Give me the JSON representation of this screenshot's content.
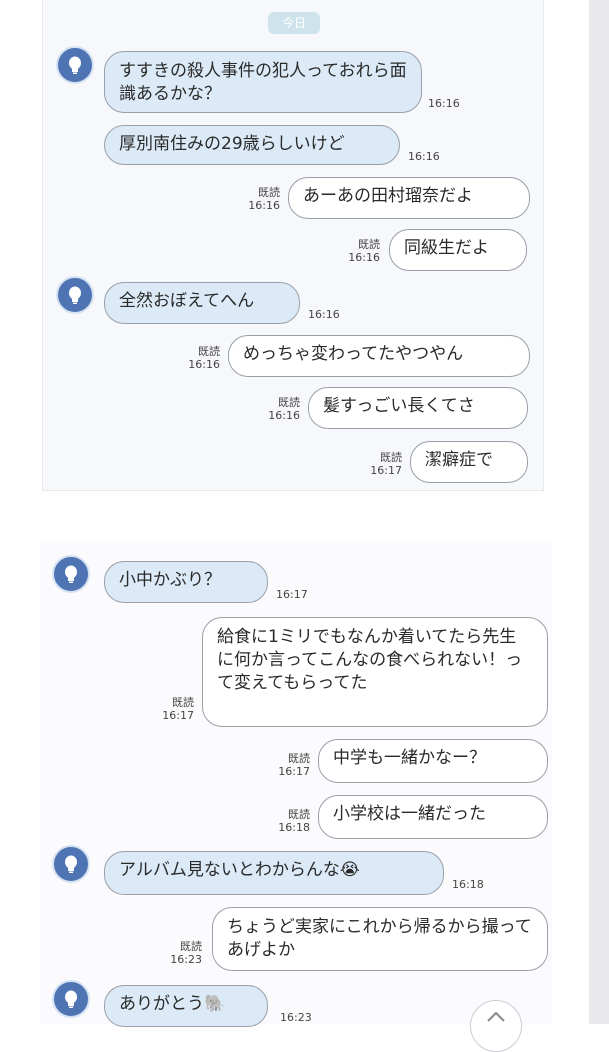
{
  "date_label": "今日",
  "read_label": "既読",
  "top_messages": [
    {
      "side": "left",
      "text": "すすきの殺人事件の犯人っておれら面識あるかな？",
      "time": "16:16"
    },
    {
      "side": "left",
      "text": "厚別南住みの29歳らしいけど",
      "time": "16:16"
    },
    {
      "side": "right",
      "text": "あーあの田村瑠奈だよ",
      "time": "16:16"
    },
    {
      "side": "right",
      "text": "同級生だよ",
      "time": "16:16"
    },
    {
      "side": "left",
      "text": "全然おぼえてへん",
      "time": "16:16"
    },
    {
      "side": "right",
      "text": "めっちゃ変わってたやつやん",
      "time": "16:16"
    },
    {
      "side": "right",
      "text": "髪すっごい長くてさ",
      "time": "16:16"
    },
    {
      "side": "right",
      "text": "潔癖症で",
      "time": "16:17"
    }
  ],
  "bottom_messages": [
    {
      "side": "left",
      "text": "小中かぶり？",
      "time": "16:17"
    },
    {
      "side": "right",
      "text": "給食に1ミリでもなんか着いてたら先生に何か言ってこんなの食べられない！って変えてもらってた",
      "time": "16:17"
    },
    {
      "side": "right",
      "text": "中学も一緒かなー？",
      "time": "16:17"
    },
    {
      "side": "right",
      "text": "小学校は一緒だった",
      "time": "16:18"
    },
    {
      "side": "left",
      "text": "アルバム見ないとわからんな😭",
      "time": "16:18"
    },
    {
      "side": "right",
      "text": "ちょうど実家にこれから帰るから撮ってあげよか",
      "time": "16:23"
    },
    {
      "side": "left",
      "text": "ありがとう🐘",
      "time": "16:23"
    }
  ],
  "colors": {
    "left_bubble": "#dbeaf6",
    "right_bubble": "#ffffff",
    "avatar": "#4f74b3",
    "date_pill": "#cfe3ec"
  },
  "icons": [
    "lightbulb-icon",
    "chevron-up-icon"
  ]
}
